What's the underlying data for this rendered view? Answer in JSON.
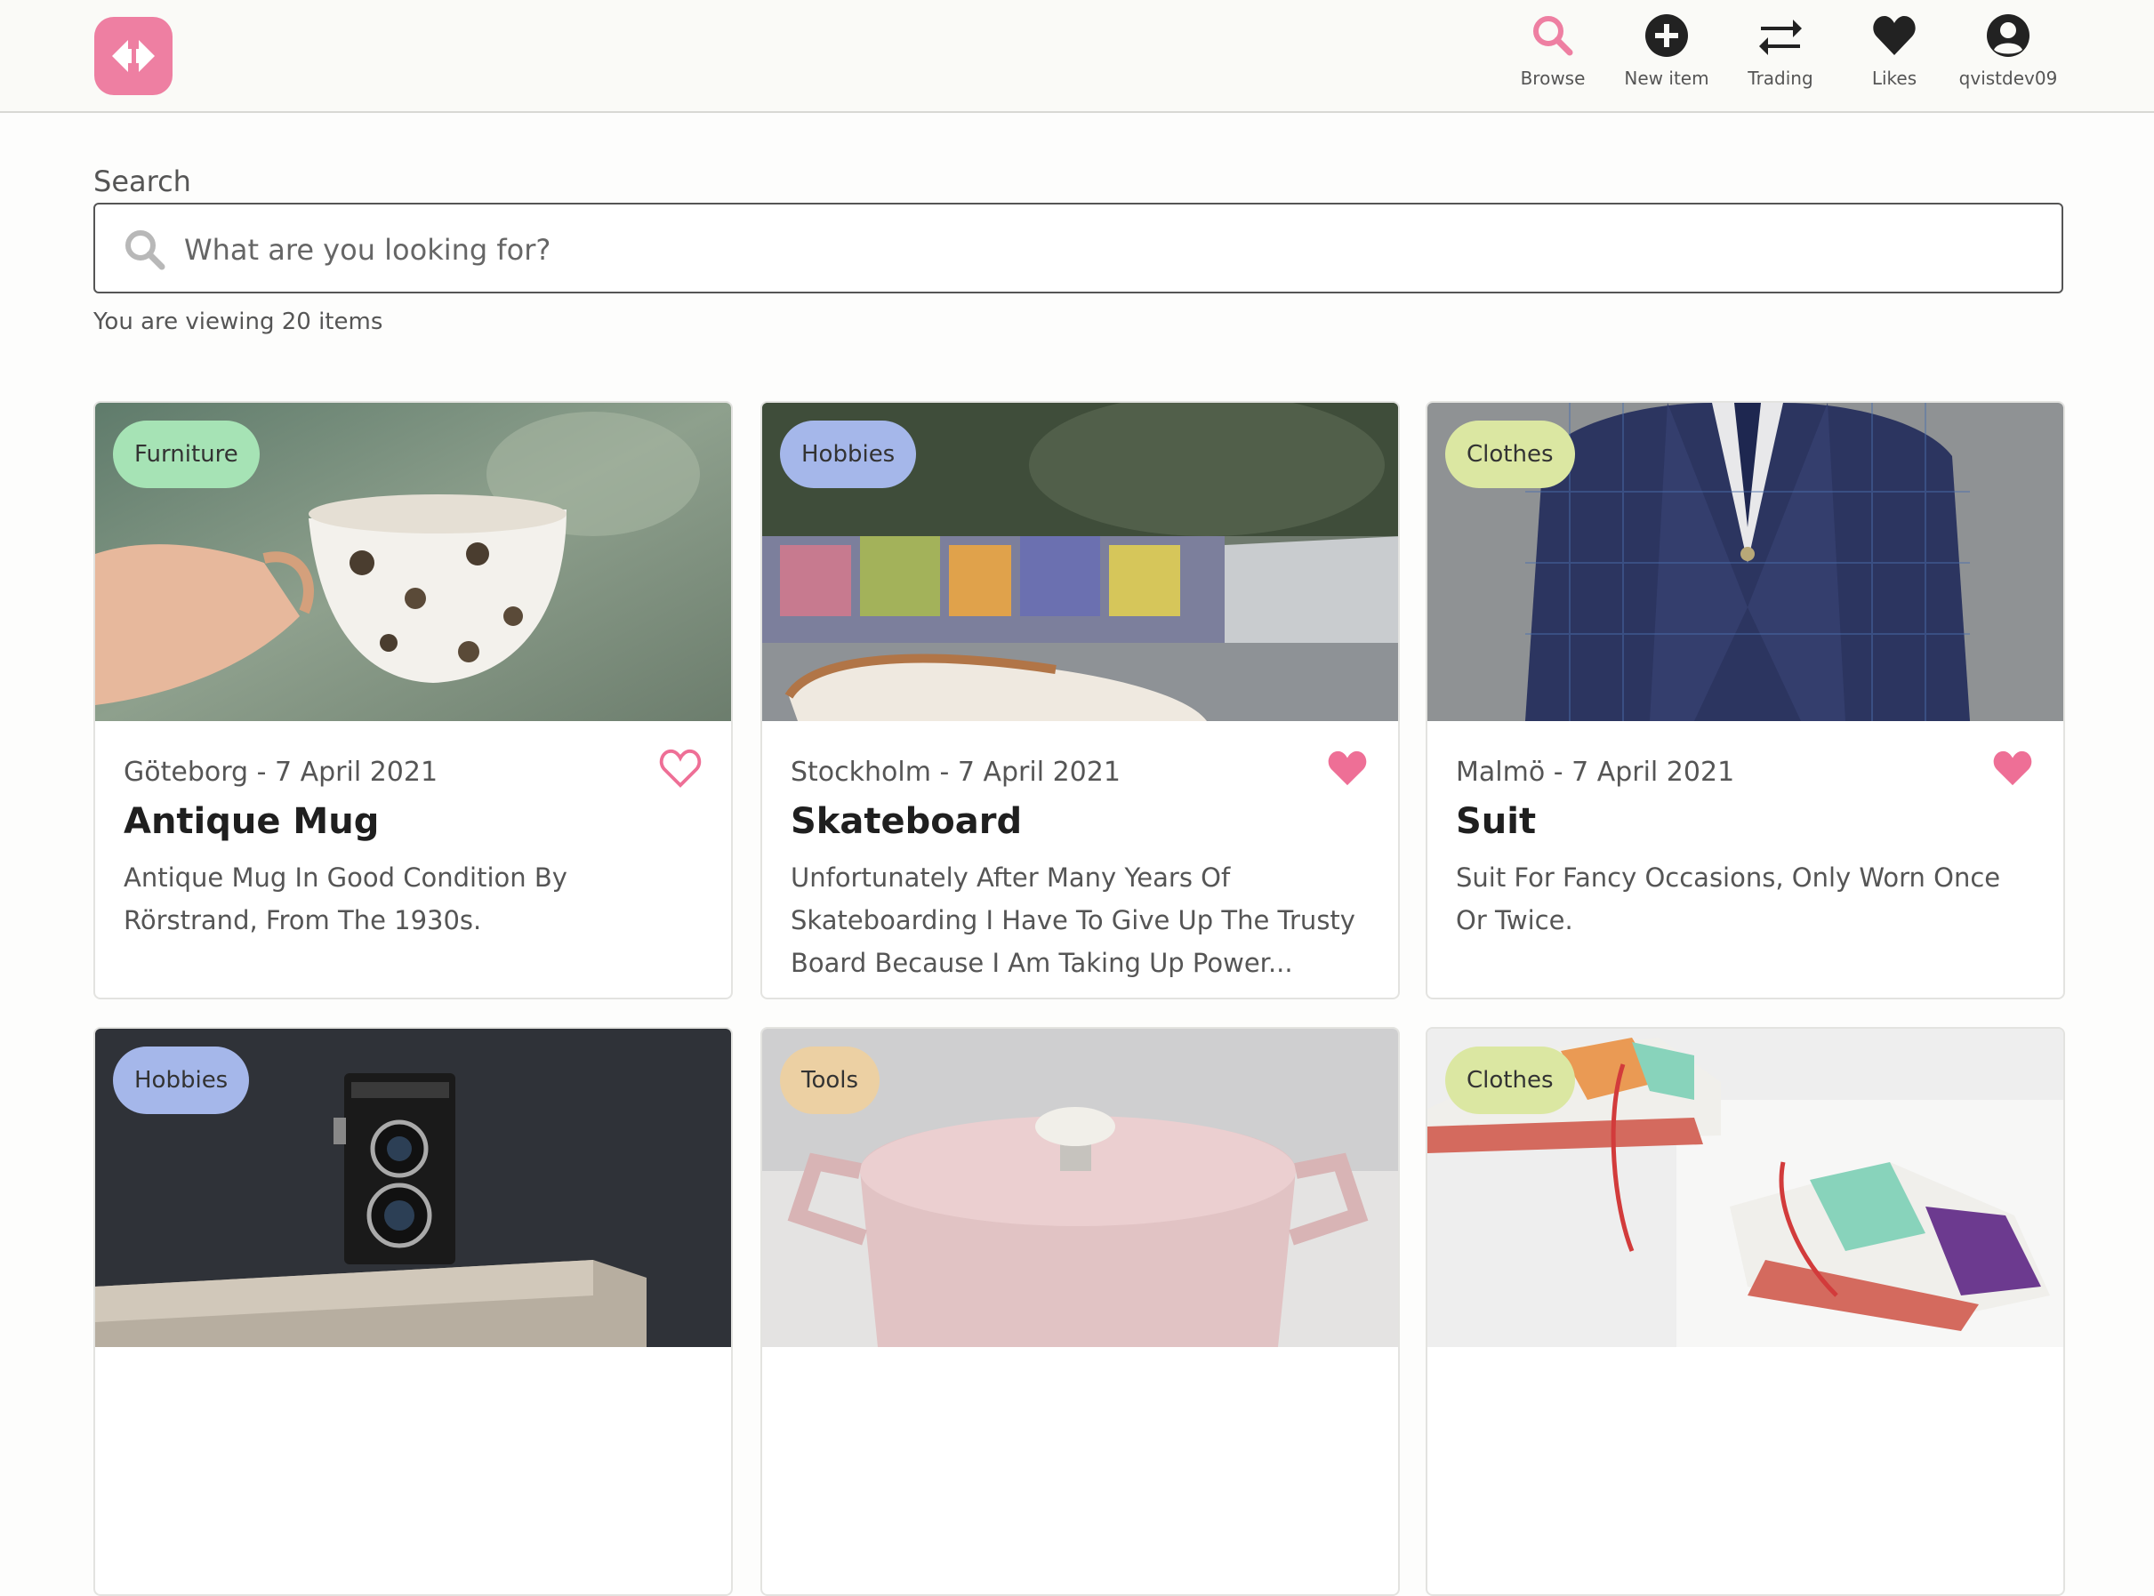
{
  "brand": {
    "accent": "#ee7fa2",
    "heart_color": "#ee6f96",
    "text_dark": "#222222",
    "logo_icon": "swap-arrows-logo"
  },
  "nav": {
    "items": [
      {
        "label": "Browse",
        "icon": "search-icon",
        "active": true
      },
      {
        "label": "New item",
        "icon": "plus-circle-icon"
      },
      {
        "label": "Trading",
        "icon": "swap-arrows-icon"
      },
      {
        "label": "Likes",
        "icon": "heart-icon"
      },
      {
        "label": "qvistdev09",
        "icon": "user-avatar-icon"
      }
    ]
  },
  "search": {
    "label": "Search",
    "placeholder": "What are you looking for?",
    "value": ""
  },
  "results": {
    "count_text": "You are viewing 20 items"
  },
  "items": [
    {
      "category": "Furniture",
      "category_color": "#a6e3b5",
      "meta": "Göteborg - 7 April 2021",
      "title": "Antique Mug",
      "description": "Antique Mug In Good Condition By Rörstrand, From The 1930s.",
      "liked": false
    },
    {
      "category": "Hobbies",
      "category_color": "#a5b7ea",
      "meta": "Stockholm - 7 April 2021",
      "title": "Skateboard",
      "description": "Unfortunately After Many Years Of Skateboarding I Have To Give Up The Trusty Board Because I Am Taking Up Power...",
      "liked": true
    },
    {
      "category": "Clothes",
      "category_color": "#dbe7a2",
      "meta": "Malmö - 7 April 2021",
      "title": "Suit",
      "description": "Suit For Fancy Occasions, Only Worn Once Or Twice.",
      "liked": true
    },
    {
      "category": "Hobbies",
      "category_color": "#a5b7ea"
    },
    {
      "category": "Tools",
      "category_color": "#ecd0a3"
    },
    {
      "category": "Clothes",
      "category_color": "#dbe7a2"
    }
  ]
}
